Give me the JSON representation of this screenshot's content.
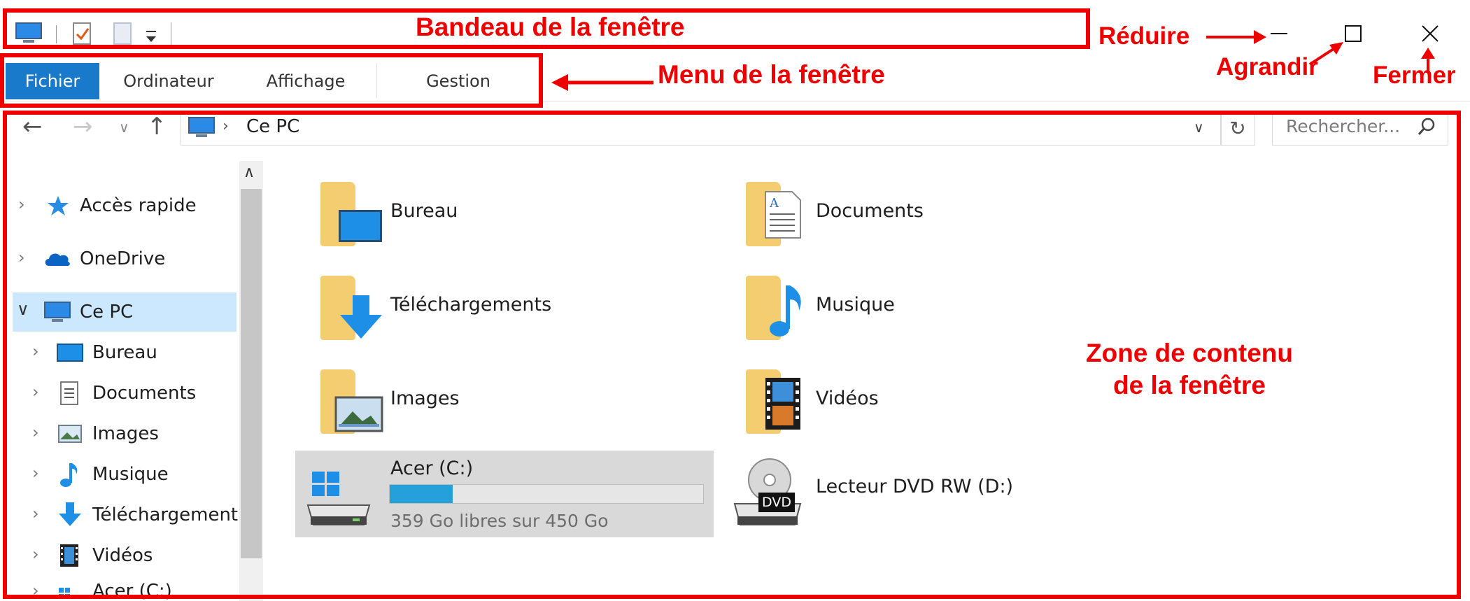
{
  "titlebar": {
    "qat_icons": [
      "computer-icon",
      "properties-icon",
      "new-folder-icon",
      "customize-dropdown-icon"
    ],
    "window_buttons": [
      "minimize-icon",
      "maximize-icon",
      "close-icon"
    ]
  },
  "ribbon": {
    "tabs": [
      {
        "label": "Fichier",
        "active": true
      },
      {
        "label": "Ordinateur",
        "active": false
      },
      {
        "label": "Affichage",
        "active": false
      },
      {
        "label": "Gestion",
        "active": false
      }
    ]
  },
  "address_bar": {
    "path": "Ce PC",
    "search_placeholder": "Rechercher..."
  },
  "nav_pane": {
    "items": [
      {
        "label": "Accès rapide",
        "icon": "star-icon"
      },
      {
        "label": "OneDrive",
        "icon": "cloud-icon"
      },
      {
        "label": "Ce PC",
        "icon": "computer-icon",
        "selected": true
      },
      {
        "label": "Bureau",
        "icon": "desktop-icon"
      },
      {
        "label": "Documents",
        "icon": "documents-icon"
      },
      {
        "label": "Images",
        "icon": "images-icon"
      },
      {
        "label": "Musique",
        "icon": "music-icon"
      },
      {
        "label": "Téléchargement",
        "icon": "download-icon"
      },
      {
        "label": "Vidéos",
        "icon": "video-icon"
      },
      {
        "label": "Acer (C:)",
        "icon": "drive-icon"
      }
    ]
  },
  "content": {
    "folders": [
      {
        "label": "Bureau",
        "icon": "desktop-folder-icon"
      },
      {
        "label": "Documents",
        "icon": "documents-folder-icon"
      },
      {
        "label": "Téléchargements",
        "icon": "downloads-folder-icon"
      },
      {
        "label": "Musique",
        "icon": "music-folder-icon"
      },
      {
        "label": "Images",
        "icon": "pictures-folder-icon"
      },
      {
        "label": "Vidéos",
        "icon": "videos-folder-icon"
      }
    ],
    "drives": [
      {
        "label": "Acer (C:)",
        "free_text": "359 Go libres sur 450 Go",
        "used_fraction": 0.2,
        "icon": "windows-drive-icon"
      },
      {
        "label": "Lecteur DVD RW (D:)",
        "badge": "DVD",
        "icon": "dvd-drive-icon"
      }
    ]
  },
  "annotations": {
    "bandeau": "Bandeau de la fenêtre",
    "menu": "Menu de la fenêtre",
    "reduire": "Réduire",
    "agrandir": "Agrandir",
    "fermer": "Fermer",
    "zone_line1": "Zone de contenu",
    "zone_line2": "de la fenêtre"
  },
  "colors": {
    "accent": "#1979ca",
    "annotation_red": "#ee0000",
    "selection": "#cce8ff",
    "folder": "#f3cd70"
  }
}
